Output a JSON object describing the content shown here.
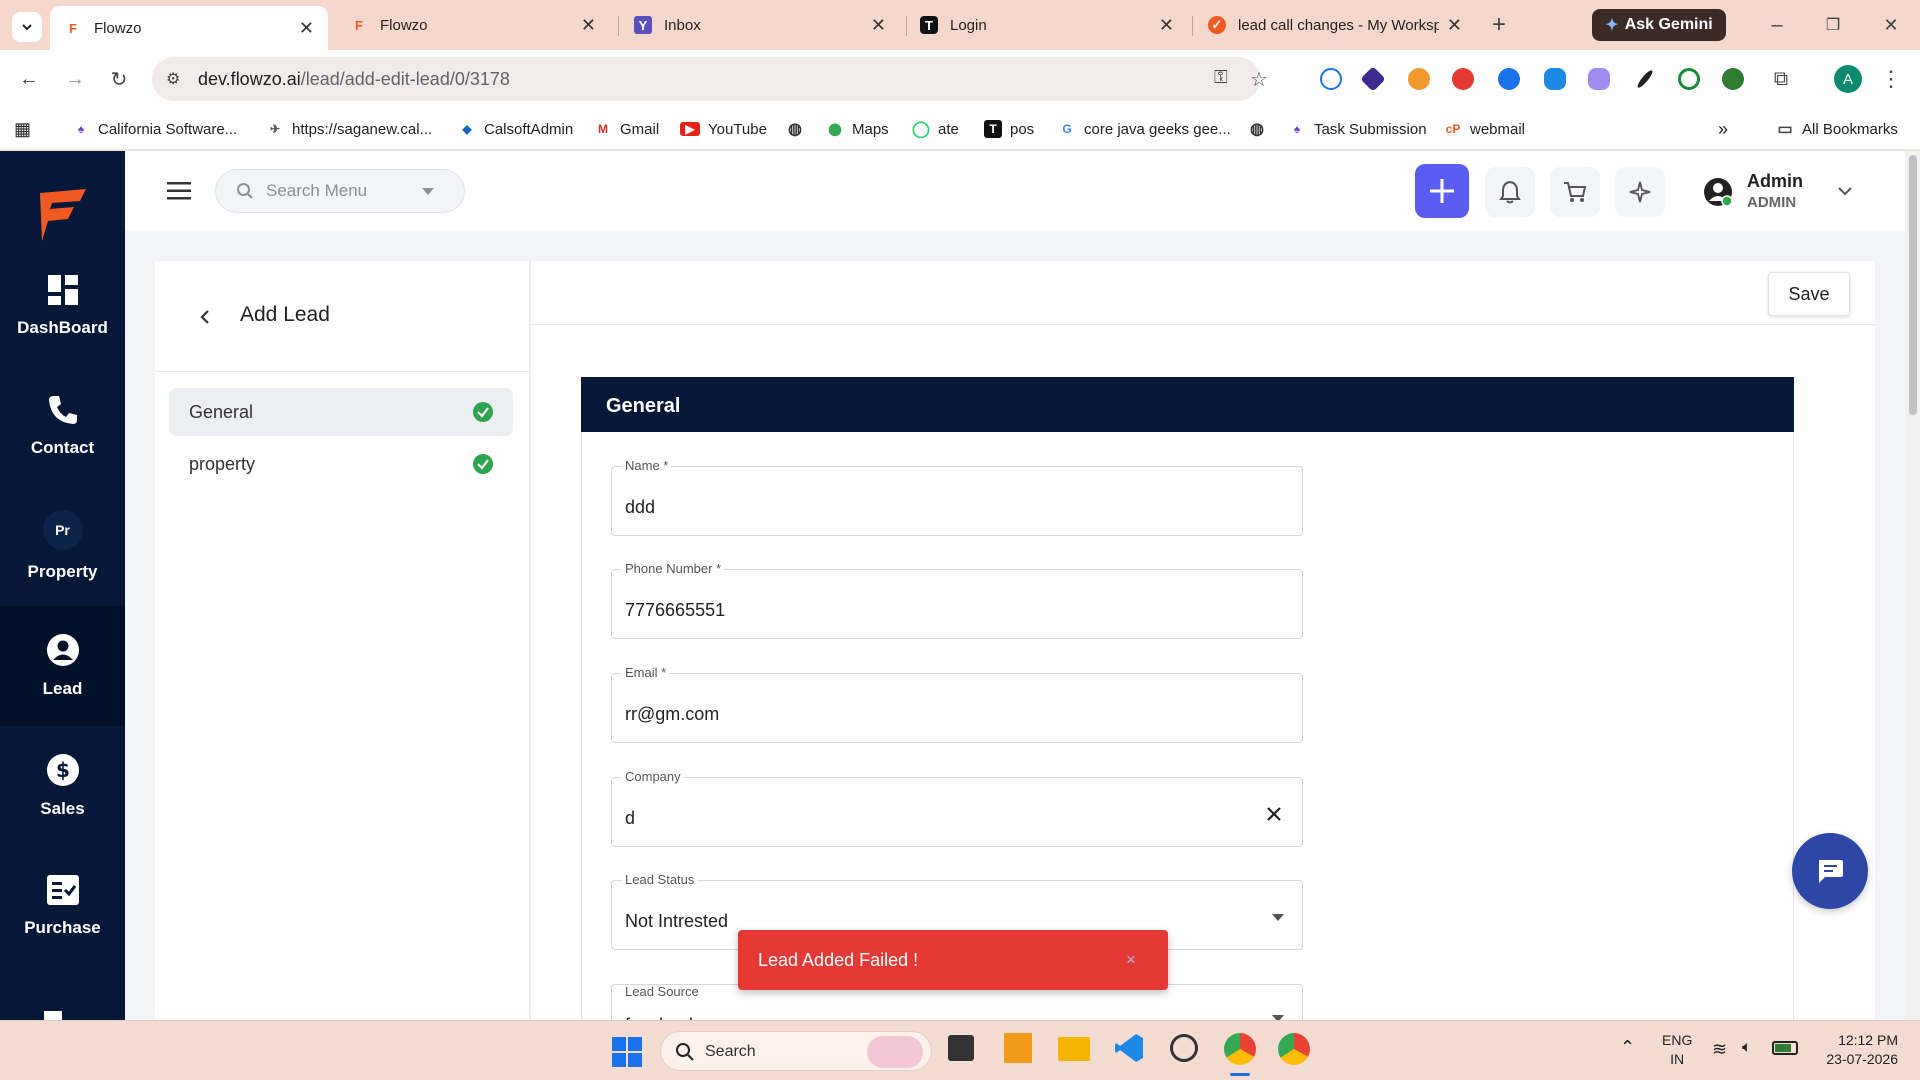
{
  "browser": {
    "tabs": [
      {
        "title": "Flowzo",
        "active": true
      },
      {
        "title": "Flowzo",
        "active": false
      },
      {
        "title": "Inbox",
        "active": false
      },
      {
        "title": "Login",
        "active": false
      },
      {
        "title": "lead call changes - My Worksp",
        "active": false
      }
    ],
    "ask_gemini": "Ask Gemini",
    "url_host": "dev.flowzo.ai",
    "url_path": "/lead/add-edit-lead/0/3178",
    "profile_initial": "A",
    "bookmarks": [
      "California Software...",
      "https://saganew.cal...",
      "CalsoftAdmin",
      "Gmail",
      "YouTube",
      "Maps",
      "ate",
      "pos",
      "core java geeks gee...",
      "Task Submission",
      "webmail"
    ],
    "all_bookmarks": "All Bookmarks"
  },
  "sidebar": {
    "items": [
      {
        "label": "DashBoard",
        "icon": "dashboard-icon"
      },
      {
        "label": "Contact",
        "icon": "phone-icon"
      },
      {
        "label": "Property",
        "icon": "property-icon",
        "badge": "Pr"
      },
      {
        "label": "Lead",
        "icon": "user-circle-icon"
      },
      {
        "label": "Sales",
        "icon": "dollar-icon"
      },
      {
        "label": "Purchase",
        "icon": "purchase-icon"
      }
    ]
  },
  "topbar": {
    "search_placeholder": "Search Menu",
    "user_name": "Admin",
    "user_role": "ADMIN"
  },
  "lead_form": {
    "title": "Add Lead",
    "save_label": "Save",
    "nav": [
      {
        "label": "General",
        "complete": true
      },
      {
        "label": "property",
        "complete": true
      }
    ],
    "section_title": "General",
    "fields": [
      {
        "label": "Name *",
        "value": "ddd"
      },
      {
        "label": "Phone Number *",
        "value": "7776665551"
      },
      {
        "label": "Email *",
        "value": "rr@gm.com"
      },
      {
        "label": "Company",
        "value": "d"
      },
      {
        "label": "Lead Status",
        "value": "Not Intrested"
      },
      {
        "label": "Lead Source",
        "value": "facebook"
      }
    ]
  },
  "toast": {
    "message": "Lead Added Failed !",
    "close": "×"
  },
  "taskbar": {
    "search": "Search",
    "lang_top": "ENG",
    "lang_bottom": "IN",
    "time": "12:12 PM",
    "date": "23-07-2026"
  },
  "colors": {
    "brand_orange": "#f05a22",
    "sidebar": "#061838",
    "accent": "#5b5cf0",
    "toast": "#e53935",
    "check": "#2ea44f"
  }
}
